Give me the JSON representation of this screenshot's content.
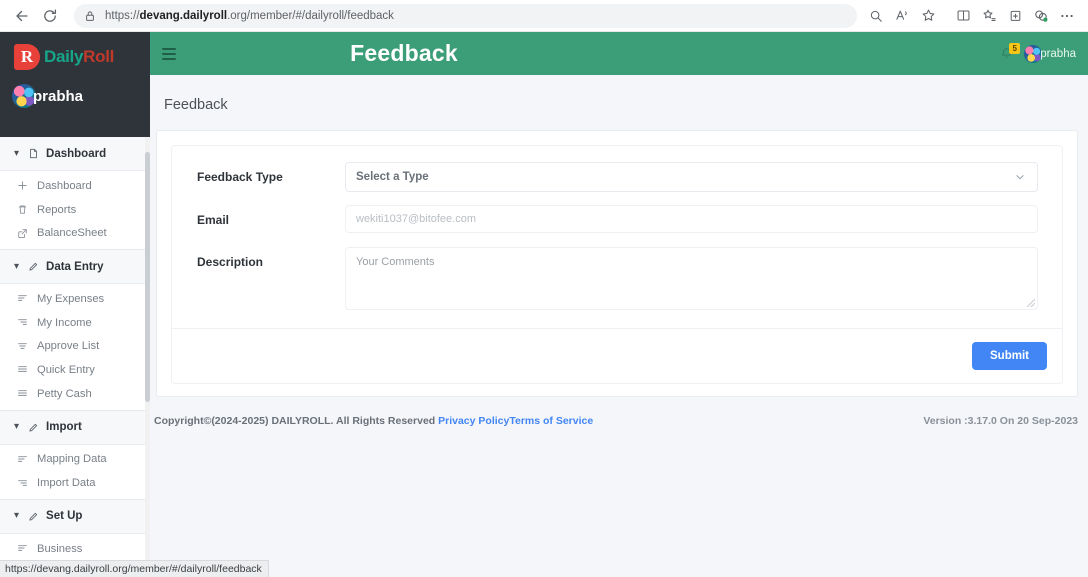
{
  "browser": {
    "back_label": "Back",
    "reload_label": "Reload",
    "url_prefix": "https://",
    "url_domain": "devang.dailyroll",
    "url_suffix": ".org/member/#/dailyroll/feedback",
    "status_url": "https://devang.dailyroll.org/member/#/dailyroll/feedback",
    "toolbar_icons": [
      "search-icon",
      "read-aloud-icon",
      "favorite-star-icon",
      "split-screen-icon",
      "favorites-list-icon",
      "collections-icon",
      "browser-essentials-icon",
      "settings-more-icon"
    ]
  },
  "sidebar": {
    "logo": {
      "mark": "R",
      "text_a": "Daily",
      "text_b": "Roll"
    },
    "profile": {
      "name": "prabha",
      "avatar": "user-avatar"
    },
    "groups": [
      {
        "title": "Dashboard",
        "icon": "file-icon",
        "items": [
          {
            "label": "Dashboard",
            "icon": "plus-icon"
          },
          {
            "label": "Reports",
            "icon": "trash-icon"
          },
          {
            "label": "BalanceSheet",
            "icon": "external-link-icon"
          }
        ]
      },
      {
        "title": "Data Entry",
        "icon": "pencil-icon",
        "items": [
          {
            "label": "My Expenses",
            "icon": "list-icon"
          },
          {
            "label": "My Income",
            "icon": "list-right-icon"
          },
          {
            "label": "Approve List",
            "icon": "list-center-icon"
          },
          {
            "label": "Quick Entry",
            "icon": "list-icon"
          },
          {
            "label": "Petty Cash",
            "icon": "list-icon"
          }
        ]
      },
      {
        "title": "Import",
        "icon": "pencil-icon",
        "items": [
          {
            "label": "Mapping Data",
            "icon": "list-icon"
          },
          {
            "label": "Import Data",
            "icon": "list-right-icon"
          }
        ]
      },
      {
        "title": "Set Up",
        "icon": "pencil-icon",
        "items": [
          {
            "label": "Business",
            "icon": "list-icon"
          }
        ]
      }
    ]
  },
  "topbar": {
    "menu_toggle": "hamburger-menu",
    "title": "Feedback",
    "notification_count": "5",
    "user_name": "prabha"
  },
  "page": {
    "title": "Feedback",
    "form": {
      "feedback_type": {
        "label": "Feedback Type",
        "value": "Select a Type"
      },
      "email": {
        "label": "Email",
        "placeholder": "wekiti1037@bitofee.com",
        "value": ""
      },
      "description": {
        "label": "Description",
        "placeholder": "Your Comments",
        "value": ""
      },
      "submit_label": "Submit"
    }
  },
  "footer": {
    "copyright": "Copyright©(2024-2025) DAILYROLL. All Rights Reserved ",
    "privacy_policy": "Privacy Policy",
    "terms_of_service": "Terms of Service",
    "version": "Version :3.17.0 On 20 Sep-2023"
  },
  "colors": {
    "topbar_green": "#3b9e78",
    "sidebar_dark": "#2f343a",
    "submit_blue": "#4285f4",
    "link_blue": "#4285f4",
    "badge_yellow": "#f5c518"
  }
}
